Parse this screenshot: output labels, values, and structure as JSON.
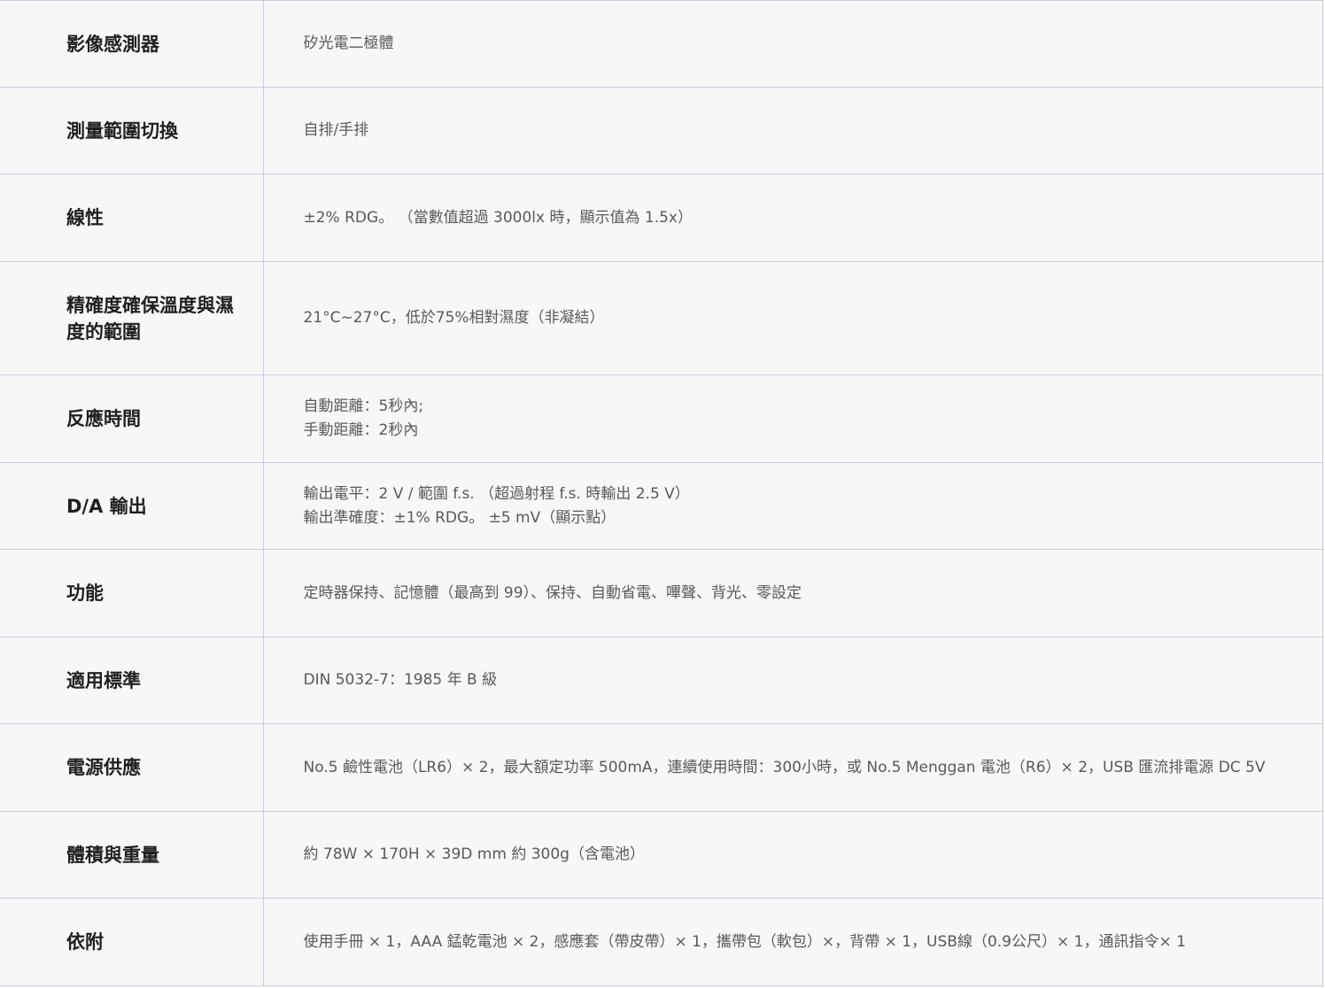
{
  "specs": {
    "rows": [
      {
        "label": "影像感測器",
        "value": [
          "矽光電二極體"
        ]
      },
      {
        "label": "測量範圍切換",
        "value": [
          "自排/手排"
        ]
      },
      {
        "label": "線性",
        "value": [
          "±2% RDG。 （當數值超過 3000lx 時，顯示值為 1.5x）"
        ]
      },
      {
        "label": "精確度確保溫度與濕度的範圍",
        "value": [
          "21°C~27°C，低於75%相對濕度（非凝結）"
        ]
      },
      {
        "label": "反應時間",
        "value": [
          "自動距離：5秒內;",
          "手動距離：2秒內"
        ]
      },
      {
        "label": "D/A 輸出",
        "value": [
          "輸出電平：2 V / 範圍 f.s. （超過射程 f.s. 時輸出 2.5 V）",
          "輸出準確度：±1% RDG。 ±5 mV（顯示點）"
        ]
      },
      {
        "label": "功能",
        "value": [
          "定時器保持、記憶體（最高到 99）、保持、自動省電、嗶聲、背光、零設定"
        ]
      },
      {
        "label": "適用標準",
        "value": [
          "DIN 5032-7：1985 年 B 級"
        ]
      },
      {
        "label": "電源供應",
        "value": [
          "No.5 鹼性電池（LR6）× 2，最大額定功率 500mA，連續使用時間：300小時，或 No.5 Menggan 電池（R6）× 2，USB 匯流排電源 DC 5V"
        ]
      },
      {
        "label": "體積與重量",
        "value": [
          "約 78W × 170H × 39D mm 約 300g（含電池）"
        ]
      },
      {
        "label": "依附",
        "value": [
          "使用手冊 × 1，AAA 錳乾電池 × 2，感應套（帶皮帶）× 1，攜帶包（軟包）×，背帶 × 1，USB線（0.9公尺）× 1，通訊指令× 1"
        ]
      }
    ]
  }
}
